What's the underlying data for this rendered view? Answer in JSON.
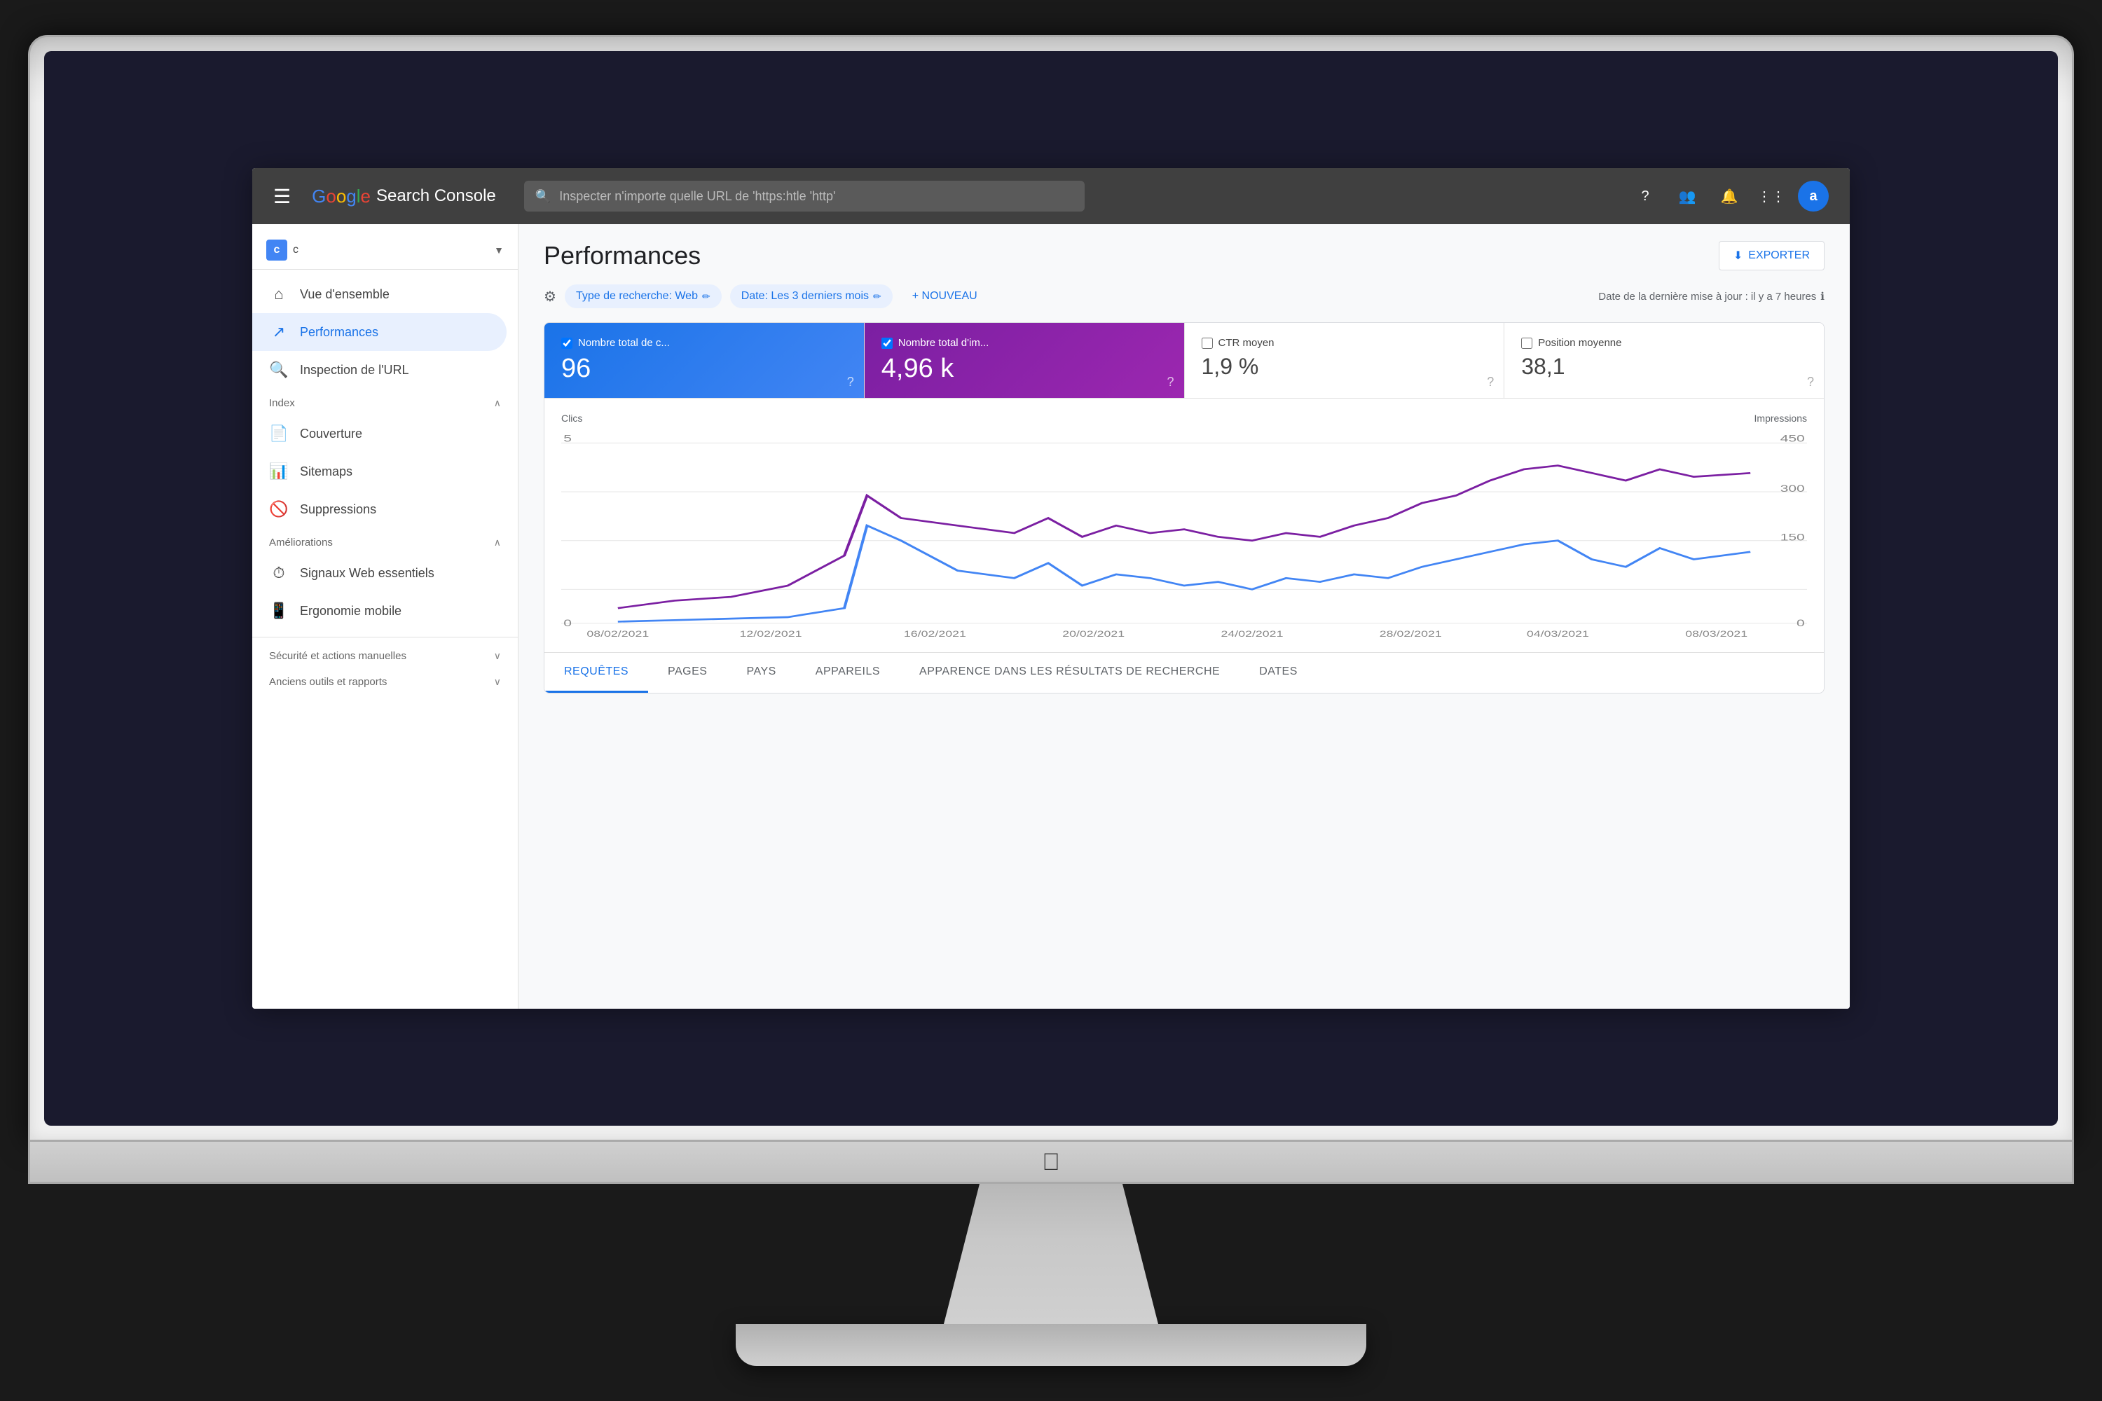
{
  "app": {
    "title": "Google Search Console",
    "brand": {
      "google": "Google",
      "search_console": "Search Console"
    }
  },
  "header": {
    "search_placeholder": "Inspecter n'importe quelle URL de 'https:htle 'http'",
    "hamburger_label": "☰",
    "avatar_initial": "a"
  },
  "sidebar": {
    "site_name": "c",
    "nav_items": [
      {
        "id": "overview",
        "label": "Vue d'ensemble",
        "icon": "⌂",
        "active": false
      },
      {
        "id": "performances",
        "label": "Performances",
        "icon": "↗",
        "active": true
      },
      {
        "id": "url-inspection",
        "label": "Inspection de l'URL",
        "icon": "🔍",
        "active": false
      }
    ],
    "index_section": {
      "title": "Index",
      "items": [
        {
          "id": "couverture",
          "label": "Couverture",
          "icon": "📄"
        },
        {
          "id": "sitemaps",
          "label": "Sitemaps",
          "icon": "📊"
        },
        {
          "id": "suppressions",
          "label": "Suppressions",
          "icon": "🚫"
        }
      ]
    },
    "ameliorations_section": {
      "title": "Améliorations",
      "items": [
        {
          "id": "signaux-web",
          "label": "Signaux Web essentiels",
          "icon": "⏱"
        },
        {
          "id": "ergonomie",
          "label": "Ergonomie mobile",
          "icon": "📱"
        }
      ]
    },
    "securite_section": {
      "title": "Sécurité et actions manuelles",
      "collapsed": true
    },
    "anciens_section": {
      "title": "Anciens outils et rapports",
      "collapsed": true
    }
  },
  "content": {
    "page_title": "Performances",
    "export_label": "EXPORTER",
    "filters": {
      "filter_icon": "filter",
      "chips": [
        {
          "label": "Type de recherche: Web",
          "has_edit": true
        },
        {
          "label": "Date: Les 3 derniers mois",
          "has_edit": true
        }
      ],
      "new_label": "+ NOUVEAU"
    },
    "update_info": "Date de la dernière mise à jour : il y a 7 heures",
    "metrics": [
      {
        "id": "clics",
        "label": "Nombre total de c...",
        "value": "96",
        "selected": true,
        "style": "blue"
      },
      {
        "id": "impressions",
        "label": "Nombre total d'im...",
        "value": "4,96 k",
        "selected": true,
        "style": "purple"
      },
      {
        "id": "ctr",
        "label": "CTR moyen",
        "value": "1,9 %",
        "selected": false,
        "style": "unselected"
      },
      {
        "id": "position",
        "label": "Position moyenne",
        "value": "38,1",
        "selected": false,
        "style": "unselected"
      }
    ],
    "chart": {
      "left_label": "Clics",
      "right_label": "Impressions",
      "y_right_values": [
        "450",
        "300",
        "150",
        "0"
      ],
      "x_dates": [
        "08/02/2021",
        "12/02/2021",
        "16/02/2021",
        "20/02/2021",
        "24/02/2021",
        "28/02/2021",
        "04/03/2021",
        "08/03/2021"
      ]
    },
    "tabs": [
      {
        "id": "requetes",
        "label": "REQUÊTES",
        "active": true
      },
      {
        "id": "pages",
        "label": "PAGES",
        "active": false
      },
      {
        "id": "pays",
        "label": "PAYS",
        "active": false
      },
      {
        "id": "appareils",
        "label": "APPAREILS",
        "active": false
      },
      {
        "id": "apparence",
        "label": "APPARENCE DANS LES RÉSULTATS DE RECHERCHE",
        "active": false
      },
      {
        "id": "dates",
        "label": "DATES",
        "active": false
      }
    ]
  },
  "colors": {
    "blue_metric": "#1a73e8",
    "purple_metric": "#7b1fa2",
    "accent_blue": "#4285f4",
    "line_blue": "#4285f4",
    "line_purple": "#7b1fa2",
    "bg_dark": "#1a1a1a",
    "bg_screen": "#404040"
  }
}
